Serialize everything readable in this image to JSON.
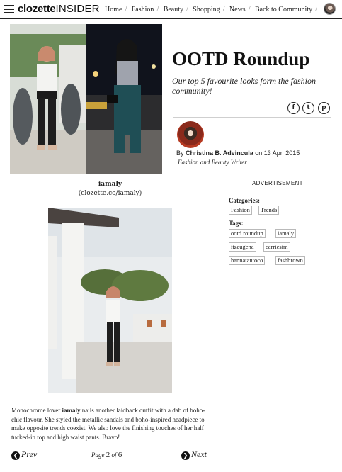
{
  "header": {
    "logo_main": "clozette",
    "logo_sub": "INSIDER",
    "nav": [
      "Home",
      "Fashion",
      "Beauty",
      "Shopping",
      "News",
      "Back to Community"
    ],
    "nav_sep": "/"
  },
  "hero": {
    "caption_name": "iamaly",
    "caption_link": "(clozette.co/iamaly)"
  },
  "article": {
    "title": "OOTD Roundup",
    "subtitle": "Our top 5 favourite looks form the fashion community!",
    "share": [
      {
        "icon": "facebook-icon",
        "glyph": "f"
      },
      {
        "icon": "twitter-icon",
        "glyph": "t"
      },
      {
        "icon": "pinterest-icon",
        "glyph": "p"
      }
    ],
    "by_prefix": "By ",
    "author": "Christina B. Advincula",
    "date_prefix": " on 13 Apr, 2015",
    "author_role": "Fashion and Beauty Writer",
    "body_prefix": "Monochrome lover ",
    "body_name": "iamaly",
    "body_rest": " nails another laidback outfit with a dab of boho-chic flavour. She styled the metallic sandals and boho-inspired headpiece to make opposite trends coexist. We also love the finishing touches of her half tucked-in top and high waist pants. Bravo!"
  },
  "sidebar": {
    "advertisement": "ADVERTISEMENT",
    "categories_label": "Categories:",
    "categories": [
      "Fashion",
      "Trends"
    ],
    "tags_label": "Tags:",
    "tags": [
      "ootd roundup",
      "iamaly",
      "itzeugena",
      "carriesim",
      "hannatantoco",
      "fashbrown"
    ]
  },
  "pagination": {
    "prev": "Prev",
    "next": "Next",
    "page_label": "Page ",
    "current": "2",
    "of": " of ",
    "total": "6"
  }
}
